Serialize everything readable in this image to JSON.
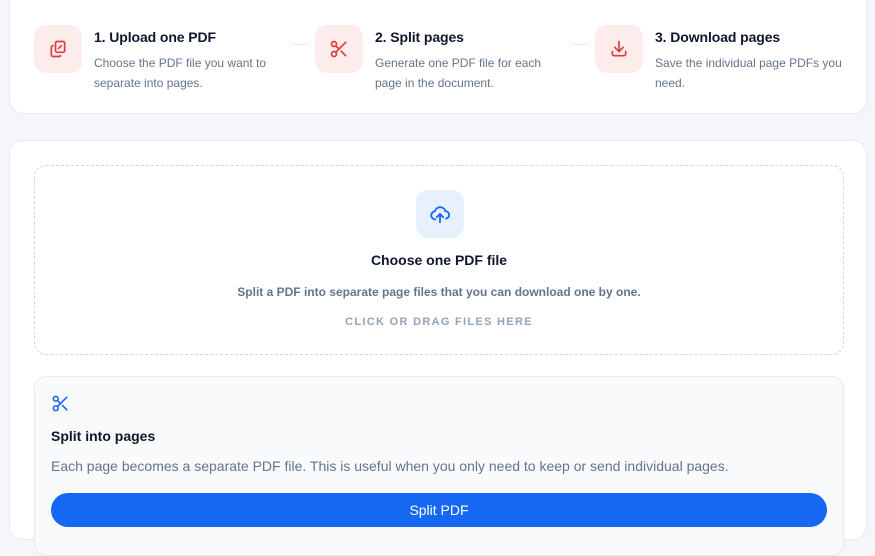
{
  "steps": [
    {
      "title": "1. Upload one PDF",
      "desc": "Choose the PDF file you want to separate into pages.",
      "icon": "copy-icon"
    },
    {
      "title": "2. Split pages",
      "desc": "Generate one PDF file for each page in the document.",
      "icon": "scissors-icon"
    },
    {
      "title": "3. Download pages",
      "desc": "Save the individual page PDFs you need.",
      "icon": "download-icon"
    }
  ],
  "dropzone": {
    "icon": "cloud-upload-icon",
    "title": "Choose one PDF file",
    "subtitle": "Split a PDF into separate page files that you can download one by one.",
    "cta": "CLICK OR DRAG FILES HERE"
  },
  "split": {
    "icon": "scissors-icon",
    "title": "Split into pages",
    "description": "Each page becomes a separate PDF file. This is useful when you only need to keep or send individual pages.",
    "button_label": "Split PDF"
  },
  "colors": {
    "accent_blue": "#1668f2",
    "step_icon_red": "#e23b3b",
    "step_icon_bg": "#fdecec",
    "upload_icon_bg": "#e8f0fe"
  }
}
